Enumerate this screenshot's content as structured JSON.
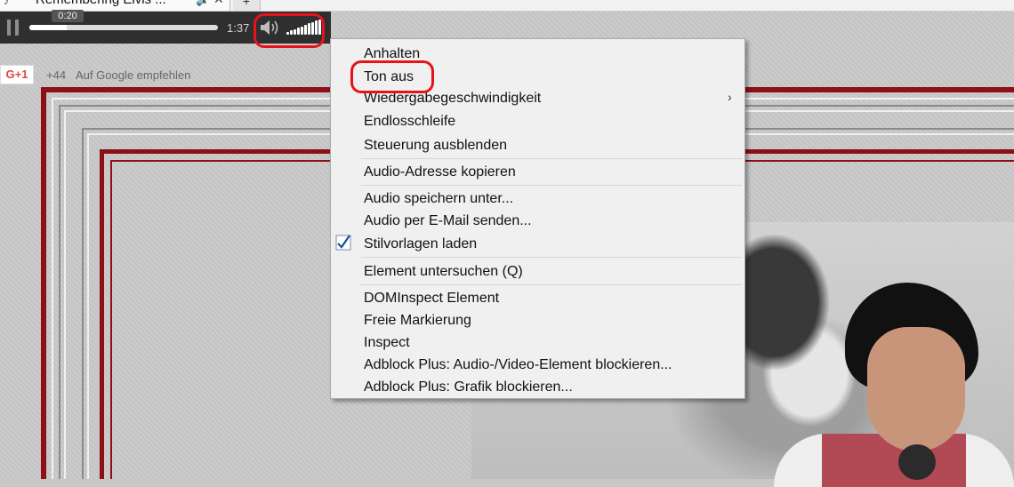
{
  "browser": {
    "tab_title": "Remembering Elvis ...",
    "tab_close_icon": "close-icon",
    "new_tab_label": "+"
  },
  "player": {
    "tooltip_time": "0:20",
    "duration": "1:37",
    "progress_fraction": 0.2,
    "volume_level": 1.0
  },
  "gplus": {
    "button_label": "G+1",
    "count": "+44",
    "recommend_label": "Auf Google empfehlen"
  },
  "menu": {
    "items": [
      {
        "label": "Anhalten"
      },
      {
        "label": "Ton aus"
      },
      {
        "label": "Wiedergabegeschwindigkeit",
        "has_submenu": true
      },
      {
        "label": "Endlosschleife"
      },
      {
        "label": "Steuerung ausblenden"
      },
      {
        "label": "Audio-Adresse kopieren"
      },
      {
        "label": "Audio speichern unter..."
      },
      {
        "label": "Audio per E-Mail senden..."
      },
      {
        "label": "Stilvorlagen laden",
        "checked": true
      },
      {
        "label": "Element untersuchen (Q)"
      },
      {
        "label": "DOMInspect Element"
      },
      {
        "label": "Freie Markierung"
      },
      {
        "label": "Inspect"
      },
      {
        "label": "Adblock Plus: Audio-/Video-Element blockieren..."
      },
      {
        "label": "Adblock Plus: Grafik blockieren..."
      }
    ],
    "submenu_arrow": "›"
  },
  "colors": {
    "annotation_red": "#e8121a",
    "frame_red": "#8c1015",
    "player_bg": "#2f2f2f"
  }
}
